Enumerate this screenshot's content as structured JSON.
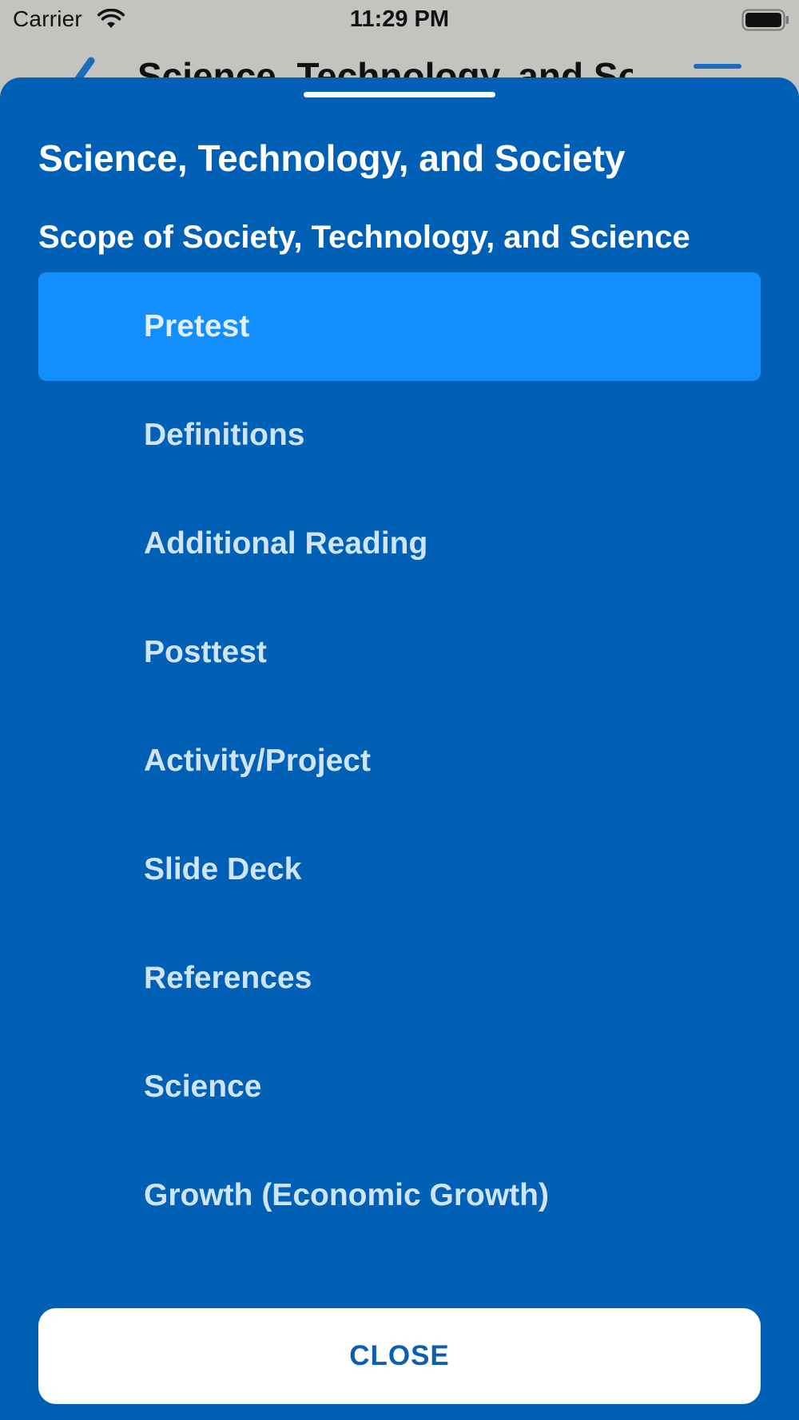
{
  "status_bar": {
    "carrier": "Carrier",
    "time": "11:29 PM",
    "wifi_icon": "wifi-icon",
    "battery_icon": "battery-icon"
  },
  "background_page": {
    "title": "Science, Technology, and Society",
    "back_icon": "chevron-left-icon",
    "menu_icon": "menu-icon"
  },
  "sheet": {
    "title": "Science, Technology, and Society",
    "subtitle": "Scope of Society, Technology, and Science",
    "items": [
      {
        "label": "Pretest",
        "selected": true
      },
      {
        "label": "Definitions",
        "selected": false
      },
      {
        "label": "Additional Reading",
        "selected": false
      },
      {
        "label": "Posttest",
        "selected": false
      },
      {
        "label": "Activity/Project",
        "selected": false
      },
      {
        "label": "Slide Deck",
        "selected": false
      },
      {
        "label": "References",
        "selected": false
      },
      {
        "label": "Science",
        "selected": false
      },
      {
        "label": "Growth (Economic Growth)",
        "selected": false
      }
    ],
    "close_label": "CLOSE"
  },
  "colors": {
    "sheet_background": "#0060b6",
    "selected_item": "#138ffd",
    "item_text": "#cfe4f7",
    "close_text": "#0a5fb2"
  }
}
